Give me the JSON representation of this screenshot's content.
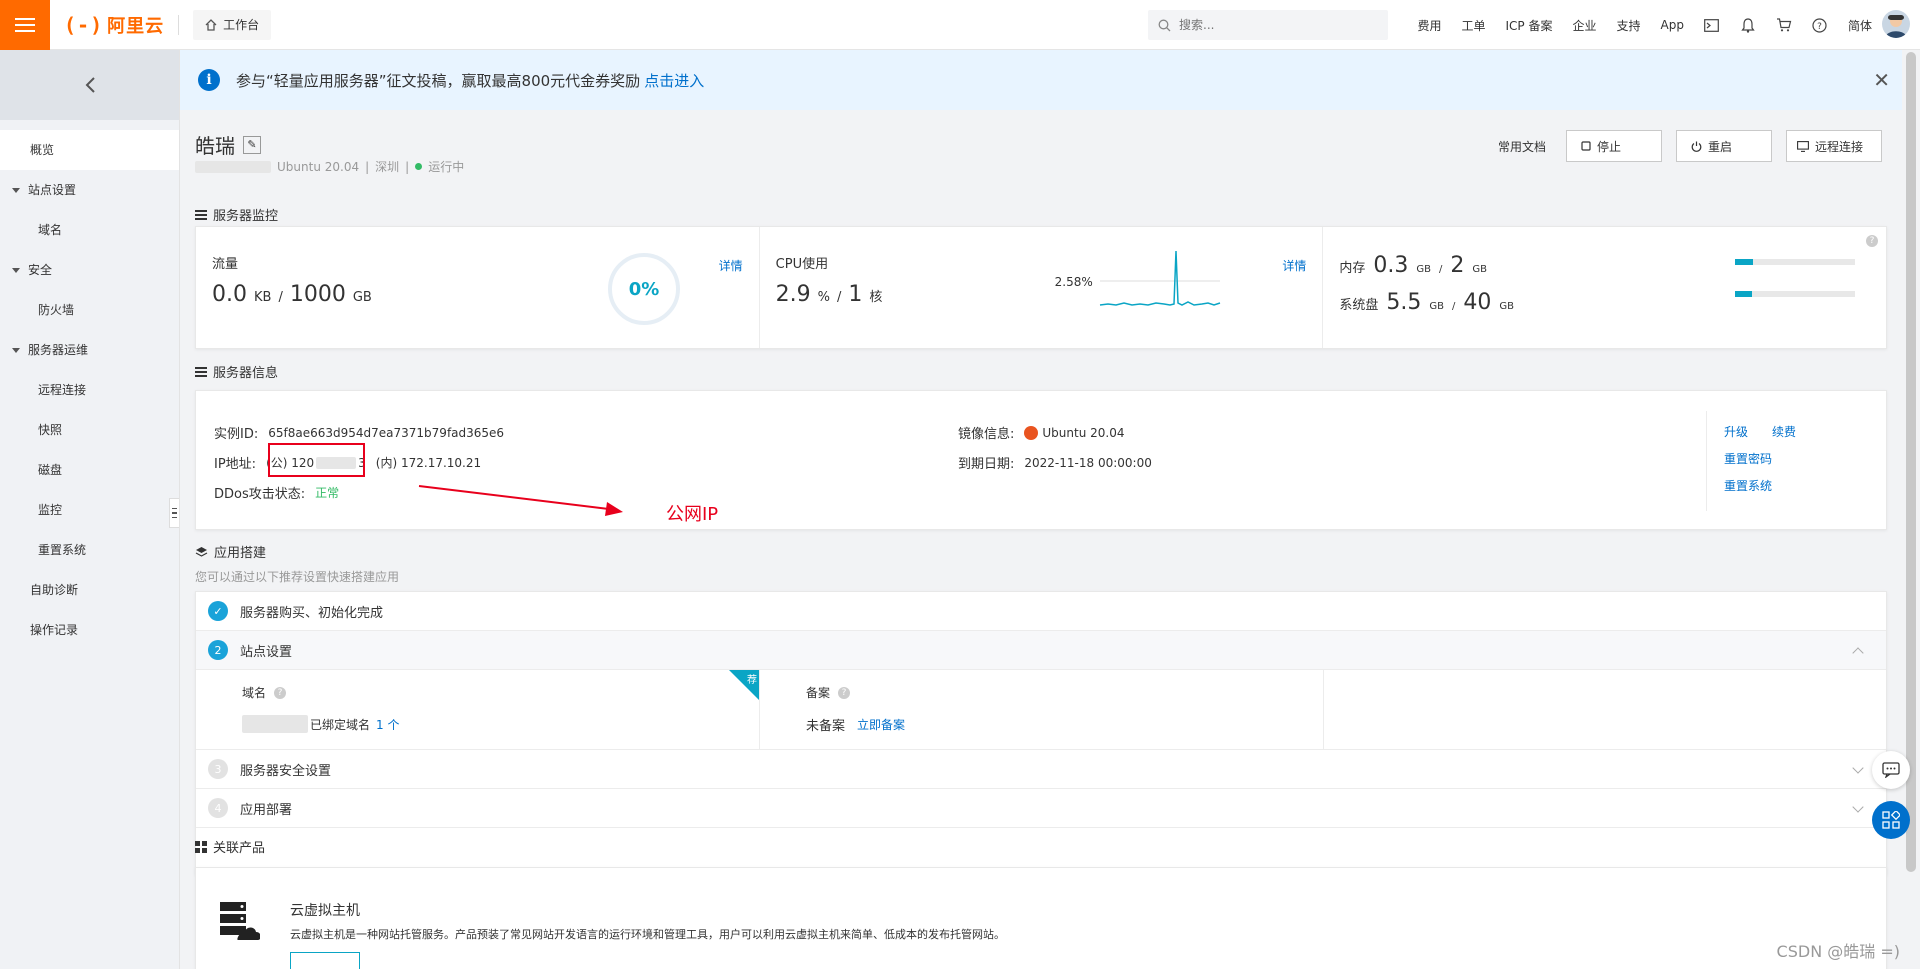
{
  "topbar": {
    "logo_text": "阿里云",
    "workbench": "工作台",
    "search_placeholder": "搜索...",
    "nav": [
      "费用",
      "工单",
      "ICP 备案",
      "企业",
      "支持",
      "App"
    ],
    "lang": "简体"
  },
  "sidebar": {
    "overview": "概览",
    "groups": [
      {
        "label": "站点设置",
        "items": [
          "域名"
        ]
      },
      {
        "label": "安全",
        "items": [
          "防火墙"
        ]
      },
      {
        "label": "服务器运维",
        "items": [
          "远程连接",
          "快照",
          "磁盘",
          "监控",
          "重置系统"
        ]
      }
    ],
    "self_diagnosis": "自助诊断",
    "op_log": "操作记录"
  },
  "notice": {
    "text": "参与“轻量应用服务器”征文投稿，赢取最高800元代金券奖励",
    "link": "点击进入"
  },
  "server": {
    "name": "皓瑞",
    "os": "Ubuntu 20.04",
    "region": "深圳",
    "status": "运行中"
  },
  "actions": {
    "docs": "常用文档",
    "stop": "停止",
    "restart": "重启",
    "remote": "远程连接"
  },
  "monitor": {
    "section": "服务器监控",
    "traffic": {
      "label": "流量",
      "used": "0.0",
      "used_unit": "KB",
      "sep": "/",
      "total": "1000",
      "total_unit": "GB",
      "percent": "0%",
      "detail": "详情"
    },
    "cpu": {
      "label": "CPU使用",
      "value": "2.9",
      "value_unit": "%",
      "sep": "/",
      "cores": "1",
      "cores_unit": "核",
      "peak": "2.58%",
      "detail": "详情"
    },
    "mem": {
      "label": "内存",
      "used": "0.3",
      "used_unit": "GB",
      "sep": "/",
      "total": "2",
      "total_unit": "GB",
      "fill": 0.15
    },
    "disk": {
      "label": "系统盘",
      "used": "5.5",
      "used_unit": "GB",
      "sep": "/",
      "total": "40",
      "total_unit": "GB",
      "fill": 0.14
    }
  },
  "info": {
    "section": "服务器信息",
    "instance_label": "实例ID:",
    "instance_id": "65f8ae663d954d7ea7371b79fad365e6",
    "ip_label": "IP地址:",
    "ip_public": "(公) 120",
    "ip_public_tail": "3",
    "ip_private": "(内) 172.17.10.21",
    "ddos_label": "DDos攻击状态:",
    "ddos_value": "正常",
    "image_label": "镜像信息:",
    "image_value": "Ubuntu 20.04",
    "expire_label": "到期日期:",
    "expire_value": "2022-11-18 00:00:00",
    "links": [
      "升级",
      "续费",
      "重置密码",
      "重置系统"
    ],
    "annotation": "公网IP"
  },
  "app": {
    "section": "应用搭建",
    "hint": "您可以通过以下推荐设置快速搭建应用",
    "steps": [
      {
        "num": "✓",
        "label": "服务器购买、初始化完成"
      },
      {
        "num": "2",
        "label": "站点设置"
      },
      {
        "num": "3",
        "label": "服务器安全设置"
      },
      {
        "num": "4",
        "label": "应用部署"
      }
    ],
    "domain_label": "域名",
    "domain_text": "已绑定域名",
    "domain_count": "1 个",
    "record_label": "备案",
    "record_status": "未备案",
    "record_link": "立即备案",
    "badge": "荐"
  },
  "related": {
    "section": "关联产品",
    "title": "云虚拟主机",
    "desc": "云虚拟主机是一种网站托管服务。产品预装了常见网站开发语言的运行环境和管理工具，用户可以利用云虚拟主机来简单、低成本的发布托管网站。"
  },
  "watermark": "CSDN @皓瑞 =)"
}
